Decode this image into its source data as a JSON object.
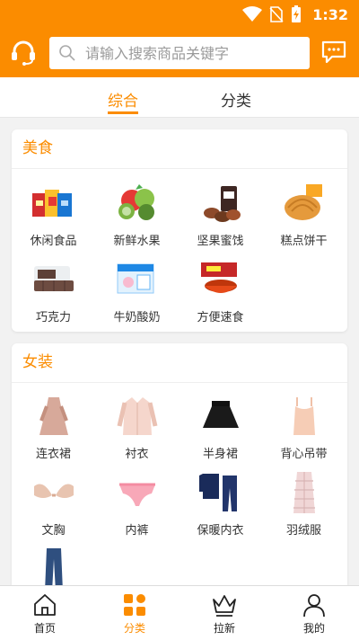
{
  "status_bar": {
    "time": "1:32"
  },
  "search": {
    "placeholder": "请输入搜索商品关键字"
  },
  "tabs": [
    {
      "label": "综合"
    },
    {
      "label": "分类"
    }
  ],
  "sections": [
    {
      "title": "美食",
      "items": [
        {
          "label": "休闲食品"
        },
        {
          "label": "新鲜水果"
        },
        {
          "label": "坚果蜜饯"
        },
        {
          "label": "糕点饼干"
        },
        {
          "label": "巧克力"
        },
        {
          "label": "牛奶酸奶"
        },
        {
          "label": "方便速食"
        }
      ]
    },
    {
      "title": "女装",
      "items": [
        {
          "label": "连衣裙"
        },
        {
          "label": "衬衣"
        },
        {
          "label": "半身裙"
        },
        {
          "label": "背心吊带"
        },
        {
          "label": "文胸"
        },
        {
          "label": "内裤"
        },
        {
          "label": "保暖内衣"
        },
        {
          "label": "羽绒服"
        }
      ]
    }
  ],
  "bottom_nav": [
    {
      "label": "首页",
      "icon": "home-icon"
    },
    {
      "label": "分类",
      "icon": "category-icon"
    },
    {
      "label": "拉新",
      "icon": "crown-icon"
    },
    {
      "label": "我的",
      "icon": "user-icon"
    }
  ],
  "colors": {
    "accent": "#fb8c00",
    "background": "#f2f2f2"
  }
}
